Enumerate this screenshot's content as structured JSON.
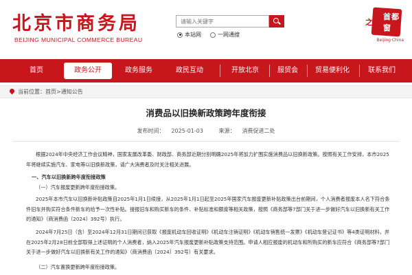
{
  "header": {
    "logo_cn": "北京市商务局",
    "logo_en": "BEIJING MUNICIPAL COMMERCE BUREAU",
    "search_placeholder": "请输入关键字",
    "scope_options": [
      {
        "label": "本站网",
        "selected": true
      },
      {
        "label": "一网通搜",
        "selected": false
      }
    ],
    "brand_chars_line1": "首",
    "brand_chars_line2": "都",
    "brand_chars_line3": "窗",
    "brand_zhi": "之",
    "brand_en": "Beijing·China",
    "brand_color": "#c8161d"
  },
  "nav": {
    "items": [
      {
        "label": "首页",
        "active": false
      },
      {
        "label": "政务公开",
        "active": true
      },
      {
        "label": "政务服务",
        "active": false
      },
      {
        "label": "政民互动",
        "active": false
      },
      {
        "label": "开放北京",
        "active": false
      },
      {
        "label": "服贸会",
        "active": false
      },
      {
        "label": "贸易便利化",
        "active": false
      },
      {
        "label": "联系我们",
        "active": false
      }
    ]
  },
  "breadcrumb": {
    "prefix": "当前位置：",
    "path": "首页>通知公告"
  },
  "article": {
    "title": "消费品以旧换新政策跨年度衔接",
    "publish_label": "发布时间：",
    "publish_date": "2025-01-03",
    "source_label": "来源：",
    "source": "消费促进二处",
    "paragraphs": [
      "根据2024年中央经济工作会议精神，国家发展改革委、财政部、商务部近期分别明确2025年将加力扩围实施消费品以旧换新政策。按照有关工作安排，本市2025年将继续实施汽车、家电等以旧换新政策，请广大消费者及时关注相关进展。",
      "一、汽车以旧换新跨年度衔接政策",
      "（一）汽车报废更新跨年度衔接政策。",
      "2025年本市汽车以旧换新补贴政策自2025年1月1日续接，从2025年1月1日起至2025年国家汽车报废更新补贴政策出台前期间，个人消费者报废本人名下符合条件旧车并购买符合条件新车的给予一次性补贴。接报旧车和购买新车的条件、补贴标准和额度等相关政策，按照《商务部等7部门关于进一步做好汽车以旧换新有关工作的通知》（商消费函〔2024〕392号）执行。",
      "2024年7月25日（含）至2024年12月31日期间已获取《报废机动车回收证明》《机动车注销证明》《机动车销售统一发票》《机动车登记证书》等4类证明材料，并在2025年2月28日前全部取得上述证明的个人消费者，纳入2025年汽车报废更新补贴政策支持范围。申请人相应报废的机动车和所购买的新车应符合《商务部等7部门关于进一步做好汽车以旧换新有关工作的通知》（商消费函〔2024〕392号）有关要求。",
      "（二）汽车置换更新跨年度衔接政策。"
    ]
  }
}
